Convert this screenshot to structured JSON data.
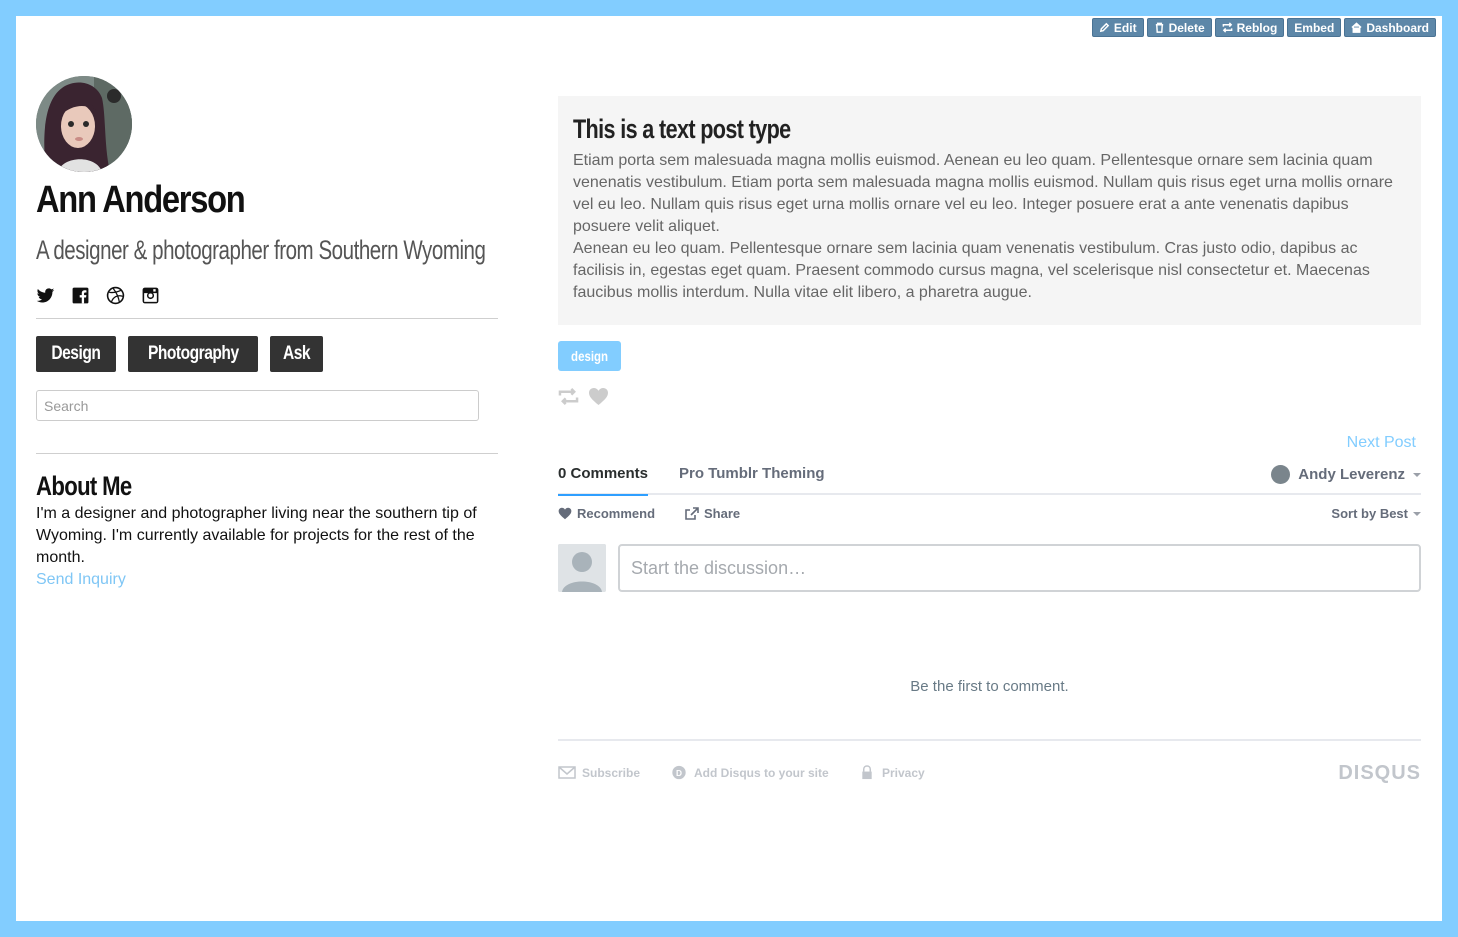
{
  "controls": {
    "edit": "Edit",
    "delete": "Delete",
    "reblog": "Reblog",
    "embed": "Embed",
    "dashboard": "Dashboard"
  },
  "blog": {
    "title": "Ann Anderson",
    "description": "A designer & photographer from Southern Wyoming",
    "social_icons": [
      "twitter-icon",
      "facebook-icon",
      "dribbble-icon",
      "instagram-icon"
    ]
  },
  "nav": {
    "items": [
      {
        "label": "Design"
      },
      {
        "label": "Photography"
      },
      {
        "label": "Ask"
      }
    ]
  },
  "search": {
    "placeholder": "Search",
    "value": ""
  },
  "about": {
    "title": "About Me",
    "text": "I'm a designer and photographer living near the southern tip of Wyoming. I'm currently available for projects for the rest of the month.",
    "link": "Send Inquiry"
  },
  "post": {
    "title": "This is a text post type",
    "paragraphs": [
      "Etiam porta sem malesuada magna mollis euismod. Aenean eu leo quam. Pellentesque ornare sem lacinia quam venenatis vestibulum. Etiam porta sem malesuada magna mollis euismod. Nullam quis risus eget urna mollis ornare vel eu leo. Nullam quis risus eget urna mollis ornare vel eu leo. Integer posuere erat a ante venenatis dapibus posuere velit aliquet.",
      "Aenean eu leo quam. Pellentesque ornare sem lacinia quam venenatis vestibulum. Cras justo odio, dapibus ac facilisis in, egestas eget quam. Praesent commodo cursus magna, vel scelerisque nisl consectetur et. Maecenas faucibus mollis interdum. Nulla vitae elit libero, a pharetra augue."
    ],
    "tag": "design",
    "next": "Next Post"
  },
  "disqus": {
    "comments_tab": "0 Comments",
    "community_tab": "Pro Tumblr Theming",
    "user": "Andy Leverenz",
    "recommend": "Recommend",
    "share": "Share",
    "sort": "Sort by Best",
    "compose_placeholder": "Start the discussion…",
    "empty": "Be the first to comment.",
    "subscribe": "Subscribe",
    "add_disqus": "Add Disqus to your site",
    "privacy": "Privacy",
    "logo": "DISQUS"
  },
  "colors": {
    "accent": "#82CDFF",
    "nav_bg": "#333333",
    "post_bg": "#F5F5F5",
    "control_bg": "#5D87A8"
  }
}
